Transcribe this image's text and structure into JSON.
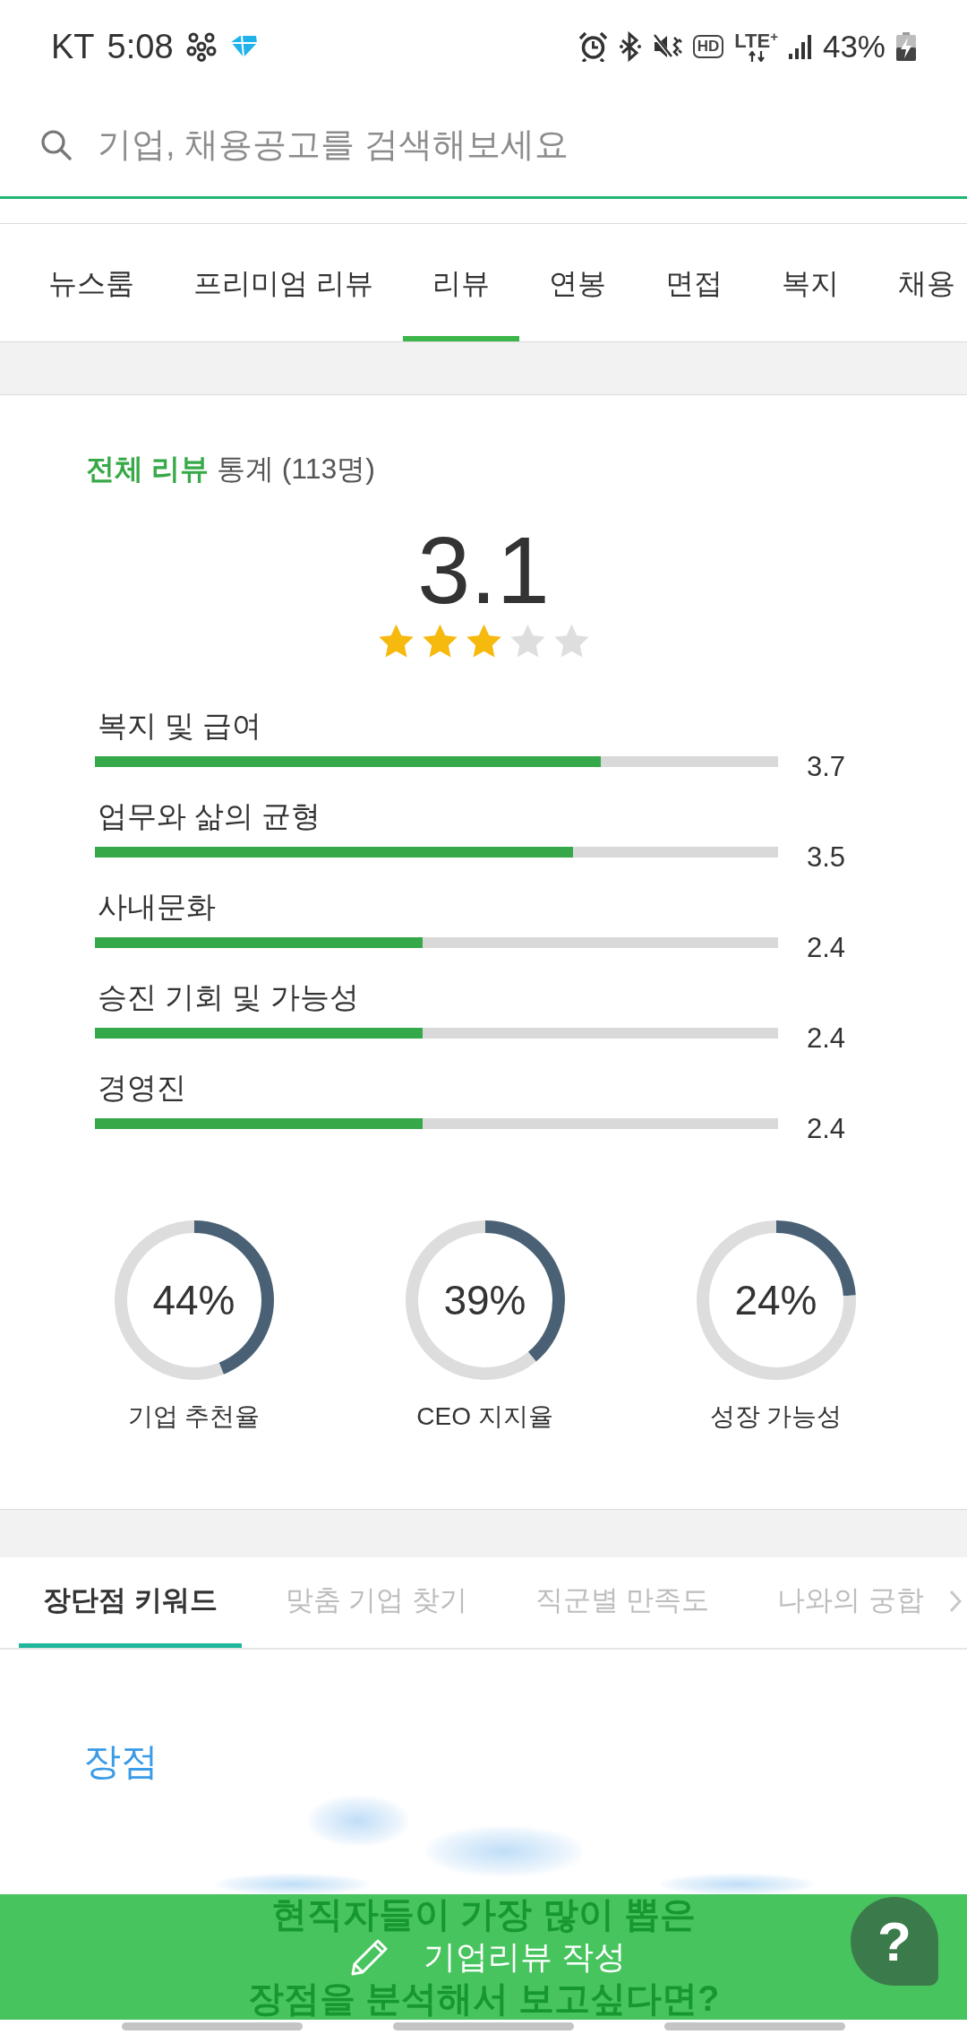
{
  "status_bar": {
    "carrier": "KT",
    "time": "5:08",
    "hd": "HD",
    "network": "LTE$^{+}$",
    "battery": "43%"
  },
  "search": {
    "placeholder": "기업, 채용공고를 검색해보세요"
  },
  "tabs": [
    {
      "label": "뉴스룸",
      "selected": false
    },
    {
      "label": "프리미엄 리뷰",
      "selected": false
    },
    {
      "label": "리뷰",
      "selected": true
    },
    {
      "label": "연봉",
      "selected": false
    },
    {
      "label": "면접",
      "selected": false
    },
    {
      "label": "복지",
      "selected": false
    },
    {
      "label": "채용",
      "selected": false
    }
  ],
  "summary": {
    "title": "**전체 리뷰** 통계 (113명)",
    "score": "3.1",
    "stars": 3
  },
  "categories": [
    {
      "name": "복지 및 급여",
      "level": 0.74,
      "score": "3.7"
    },
    {
      "name": "업무와 삶의 균형",
      "level": 0.7,
      "score": "3.5"
    },
    {
      "name": "사내문화",
      "level": 0.48,
      "score": "2.4"
    },
    {
      "name": "승진 기회 및 가능성",
      "level": 0.48,
      "score": "2.4"
    },
    {
      "name": "경영진",
      "level": 0.48,
      "score": "2.4"
    }
  ],
  "ratios": [
    {
      "value": "44%",
      "label": "기업 추천율",
      "chart_data": {
        "type": "donut",
        "values": [
          44,
          56
        ]
      }
    },
    {
      "value": "39%",
      "label": "CEO 지지율",
      "chart_data": {
        "type": "donut",
        "values": [
          39,
          61
        ]
      }
    },
    {
      "value": "24%",
      "label": "성장 가능성",
      "chart_data": {
        "type": "donut",
        "values": [
          24,
          76
        ]
      }
    }
  ],
  "sub_tabs": [
    {
      "label": "장단점 키워드",
      "selected": true
    },
    {
      "label": "맞춤 기업 찾기",
      "selected": false
    },
    {
      "label": "직군별 만족도",
      "selected": false
    },
    {
      "label": "나와의 궁합",
      "selected": false
    }
  ],
  "keywords": {
    "heading": "장점",
    "teaser": [
      "현직자들이 가장 많이 뽑은",
      "장점을 분석해서 보고싶다면?"
    ]
  },
  "write_button": {
    "label": "기업리뷰 작성"
  },
  "help_button": {
    "label": "?"
  }
}
